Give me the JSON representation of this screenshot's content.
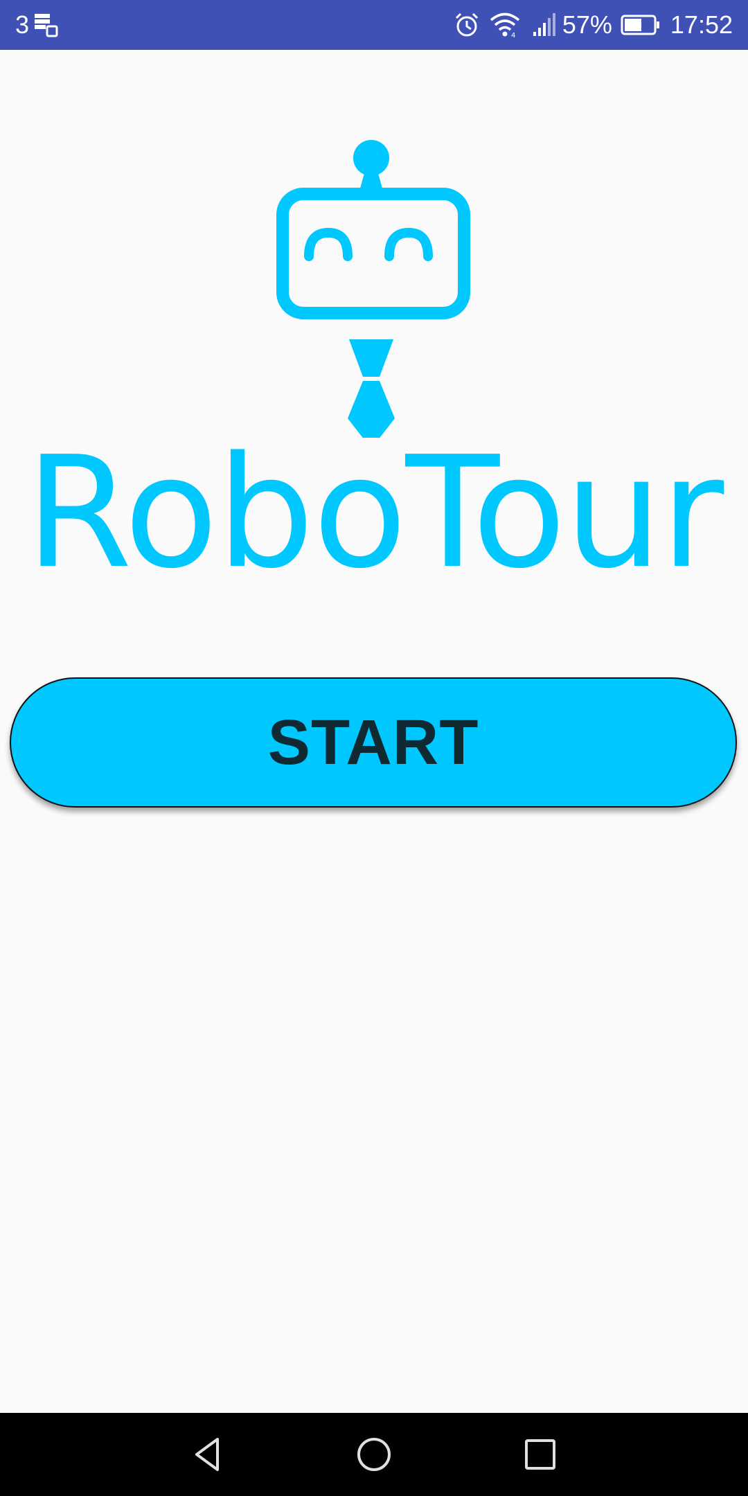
{
  "status_bar": {
    "notification_count": "3",
    "battery_percent": "57%",
    "time": "17:52",
    "icons": [
      "notification-stack-icon",
      "alarm-icon",
      "wifi-icon",
      "signal-icon",
      "battery-icon"
    ],
    "background_color": "#3f51b5"
  },
  "logo": {
    "text": "RoboTour",
    "color": "#00c8ff",
    "icon": "robot-with-tie-icon"
  },
  "main": {
    "start_button_label": "START",
    "start_button_color": "#00c8ff"
  },
  "nav_bar": {
    "icons": [
      "back-icon",
      "home-icon",
      "recents-icon"
    ]
  }
}
